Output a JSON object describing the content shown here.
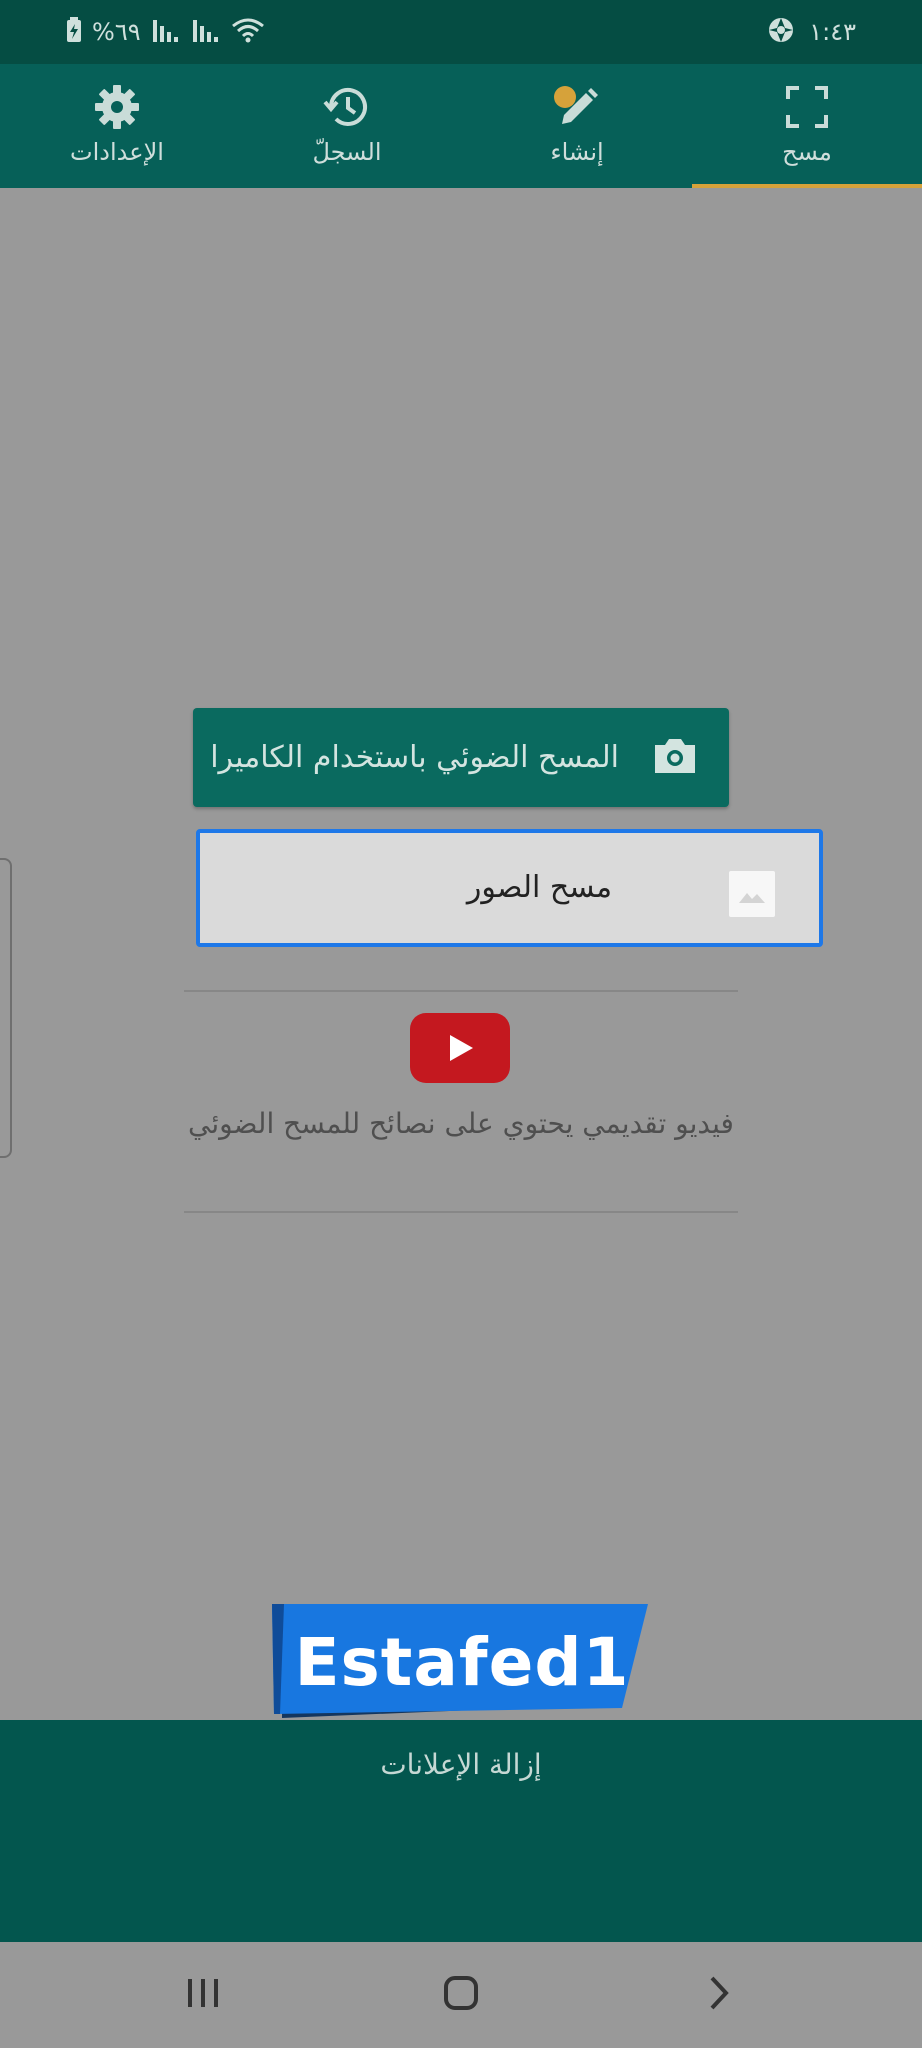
{
  "status_bar": {
    "time": "١:٤٣",
    "battery_text": "%٦٩"
  },
  "tabs": [
    {
      "label": "مسح",
      "icon": "scan-frame-icon",
      "selected": true
    },
    {
      "label": "إنشاء",
      "icon": "pencil-icon",
      "selected": false
    },
    {
      "label": "السجلّ",
      "icon": "history-icon",
      "selected": false
    },
    {
      "label": "الإعدادات",
      "icon": "gear-icon",
      "selected": false
    }
  ],
  "main": {
    "camera_button_label": "المسح الضوئي باستخدام الكاميرا",
    "scan_images_label": "مسح الصور",
    "intro_video_text": "فيديو تقديمي يحتوي على نصائح للمسح الضوئي"
  },
  "watermark_text": "Estafed1",
  "ad_bar": {
    "remove_ads_label": "إزالة الإعلانات"
  },
  "colors": {
    "status_bar": "#054d43",
    "app_bar": "#066058",
    "tab_indicator": "#d6a23a",
    "primary_button": "#0a6a5f",
    "focus_border": "#1e78e8",
    "background": "#999999",
    "ad_bar": "#03564e",
    "youtube_red": "#c4181f",
    "watermark_blue": "#1877e0"
  }
}
